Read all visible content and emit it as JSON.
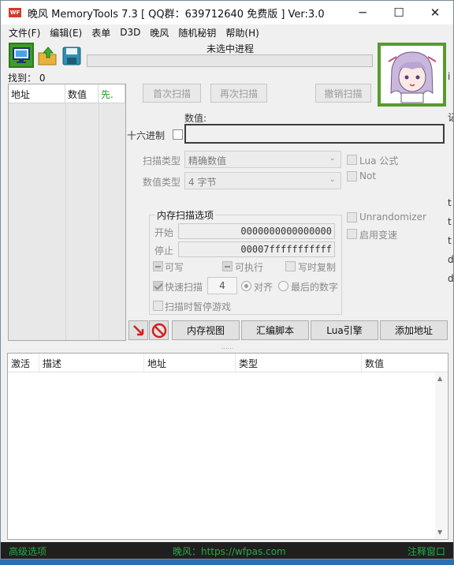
{
  "window": {
    "title": "晚风 MemoryTools 7.3 [ QQ群：639712640 免费版 ] Ver:3.0",
    "app_icon_text": "WF",
    "minimize": "─",
    "maximize": "☐",
    "close": "✕"
  },
  "menu": [
    "文件(F)",
    "编辑(E)",
    "表单",
    "D3D",
    "晚风",
    "随机秘钥",
    "帮助(H)"
  ],
  "process": {
    "label": "未选中进程",
    "progress": 0
  },
  "found": {
    "label": "找到：",
    "count": "0"
  },
  "results_columns": [
    "地址",
    "数值",
    "先."
  ],
  "scan_buttons": {
    "first": "首次扫描",
    "next": "再次扫描",
    "undo": "撤销扫描"
  },
  "value": {
    "label": "数值:",
    "hex_label": "十六进制",
    "input_value": ""
  },
  "scan_type": {
    "label": "扫描类型",
    "selected": "精确数值"
  },
  "value_type": {
    "label": "数值类型",
    "selected": "4 字节"
  },
  "options_right": {
    "lua": "Lua 公式",
    "not": "Not",
    "unrandomizer": "Unrandomizer",
    "speedhack": "启用变速"
  },
  "memory_options": {
    "title": "内存扫描选项",
    "start_label": "开始",
    "start_value": "0000000000000000",
    "stop_label": "停止",
    "stop_value": "00007fffffffffff",
    "writable": "可写",
    "executable": "可执行",
    "copy_on_write": "写时复制",
    "fast_scan": "快速扫描",
    "fast_scan_value": "4",
    "align": "对齐",
    "last_digits": "最后的数字",
    "pause_game": "扫描时暂停游戏"
  },
  "bottom_buttons": {
    "memory_view": "内存视图",
    "asm_script": "汇编脚本",
    "lua_engine": "Lua引擎",
    "add_address": "添加地址"
  },
  "splitter_grip": "......",
  "address_columns": [
    "激活",
    "描述",
    "地址",
    "类型",
    "数值"
  ],
  "edge_chars": [
    "i",
    "记",
    "t",
    "t",
    "t",
    "d",
    "d"
  ],
  "status": {
    "left": "高级选项",
    "middle": "晚风：https://wfpas.com",
    "right": "注释窗口"
  },
  "colors": {
    "status_text": "#2aa74b",
    "status_bg": "#1f1f1f",
    "logo_border": "#5a9a2c"
  },
  "icons": [
    "computer-icon",
    "open-folder-icon",
    "save-disk-icon",
    "pointer-arrow-icon",
    "no-entry-icon"
  ]
}
